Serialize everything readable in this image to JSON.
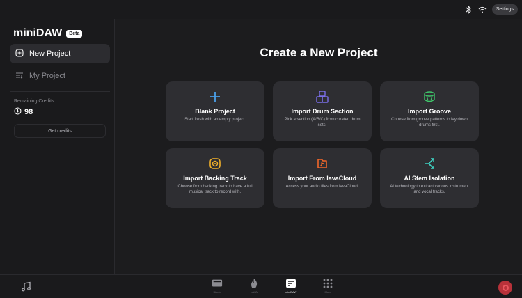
{
  "topbar": {
    "settings_label": "Settings",
    "icons": [
      "bluetooth-icon",
      "wifi-icon"
    ]
  },
  "sidebar": {
    "app_name": "miniDAW",
    "badge": "Beta",
    "nav": [
      {
        "label": "New Project",
        "icon": "plus-circle-icon",
        "active": true
      },
      {
        "label": "My Project",
        "icon": "list-icon",
        "active": false
      }
    ],
    "credits": {
      "label": "Remaining Credits",
      "value": "98",
      "button": "Get credits"
    }
  },
  "main": {
    "title": "Create a New Project",
    "cards": [
      {
        "title": "Blank Project",
        "desc": "Start fresh with an empty project.",
        "icon": "plus-icon",
        "color": "#4a9fe8"
      },
      {
        "title": "Import Drum Section",
        "desc": "Pick a section (A/B/C) from curated drum sets.",
        "icon": "drum-pads-icon",
        "color": "#7a6ee8"
      },
      {
        "title": "Import Groove",
        "desc": "Choose from groove patterns to lay down drums first.",
        "icon": "drum-icon",
        "color": "#3fc46a"
      },
      {
        "title": "Import Backing Track",
        "desc": "Choose from backing track to have a full musical track to record with.",
        "icon": "music-disc-icon",
        "color": "#f0b02a"
      },
      {
        "title": "Import From lavaCloud",
        "desc": "Access your audio files from lavaCloud.",
        "icon": "cloud-file-icon",
        "color": "#f0672a"
      },
      {
        "title": "AI Stem Isolation",
        "desc": "AI technology to extract various instrument and vocal tracks.",
        "icon": "split-icon",
        "color": "#3fd4c4"
      }
    ]
  },
  "bottombar": {
    "items": [
      {
        "label": "Studio",
        "icon": "monitor-icon",
        "active": false
      },
      {
        "label": "LAVA",
        "icon": "flame-icon",
        "active": false
      },
      {
        "label": "miniDAW",
        "icon": "minidaw-icon",
        "active": true
      },
      {
        "label": "More",
        "icon": "grid-icon",
        "active": false
      }
    ]
  }
}
